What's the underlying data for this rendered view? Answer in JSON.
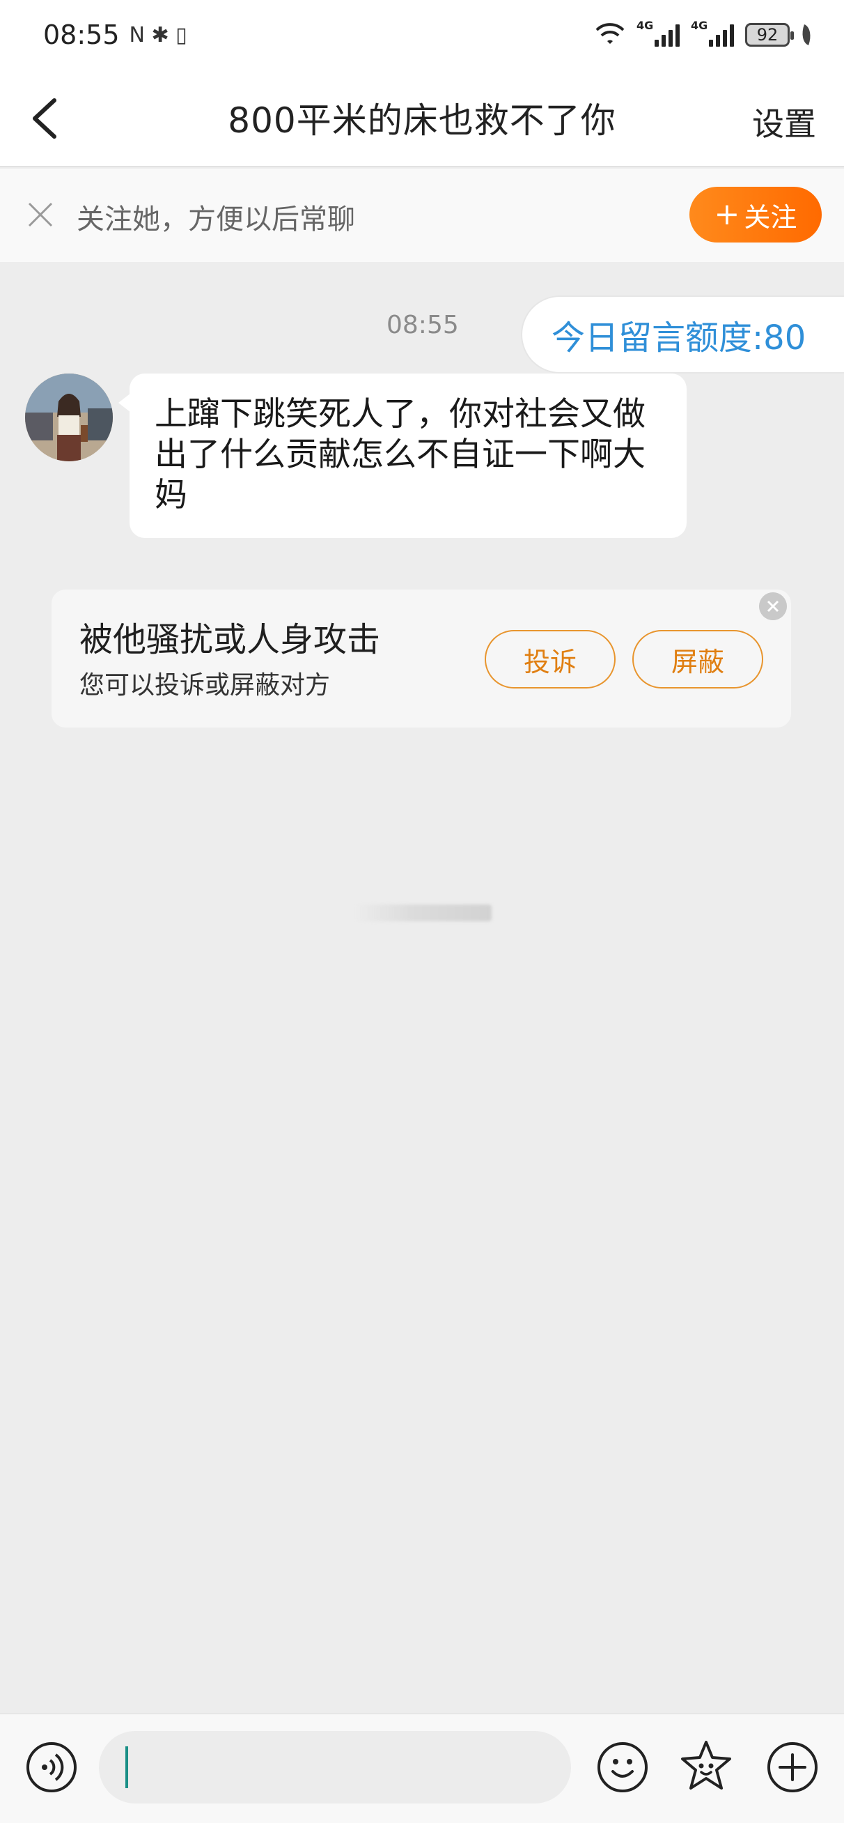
{
  "status_bar": {
    "time": "08:55",
    "sys_icons": "N ✱ ▯",
    "sim1": "4G",
    "sim2": "4G",
    "battery": "92"
  },
  "header": {
    "title": "800平米的床也救不了你",
    "settings_label": "设置"
  },
  "follow_bar": {
    "text": "关注她，方便以后常聊",
    "button_label": "关注",
    "button_plus": "+"
  },
  "chat": {
    "timestamp": "08:55",
    "quota_label": "今日留言额度:80",
    "message": "上蹿下跳笑死人了，你对社会又做出了什么贡献怎么不自证一下啊大妈"
  },
  "report_card": {
    "title": "被他骚扰或人身攻击",
    "subtitle": "您可以投诉或屏蔽对方",
    "complain_label": "投诉",
    "block_label": "屏蔽"
  },
  "input_bar": {
    "placeholder": ""
  },
  "colors": {
    "accent_orange": "#ff7a0a",
    "quota_blue": "#2f8fd8",
    "background": "#ededed"
  }
}
